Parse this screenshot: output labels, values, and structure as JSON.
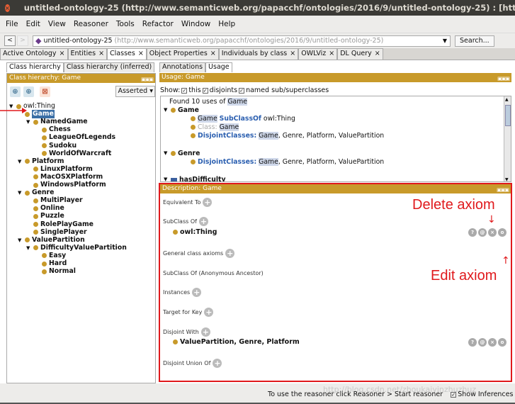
{
  "window": {
    "title": "untitled-ontology-25 (http://www.semanticweb.org/papacchf/ontologies/2016/9/untitled-ontology-25) : [http://www.semanticweb.o"
  },
  "menu": [
    "File",
    "Edit",
    "View",
    "Reasoner",
    "Tools",
    "Refactor",
    "Window",
    "Help"
  ],
  "address": {
    "back": "<",
    "forward": ">",
    "name": "untitled-ontology-25",
    "url": "(http://www.semanticweb.org/papacchf/ontologies/2016/9/untitled-ontology-25)",
    "search": "Search..."
  },
  "tabs": [
    {
      "label": "Active Ontology",
      "active": false
    },
    {
      "label": "Entities",
      "active": false
    },
    {
      "label": "Classes",
      "active": true
    },
    {
      "label": "Object Properties",
      "active": false
    },
    {
      "label": "Individuals by class",
      "active": false
    },
    {
      "label": "OWLViz",
      "active": false
    },
    {
      "label": "DL Query",
      "active": false
    }
  ],
  "left": {
    "subtabs": [
      "Class hierarchy",
      "Class hierarchy (inferred)"
    ],
    "header": "Class hierarchy: Game",
    "asserted": "Asserted ▾",
    "tree": [
      {
        "label": "owl:Thing",
        "bold": false,
        "toggle": "▼"
      },
      {
        "label": "Game",
        "bold": true,
        "toggle": "",
        "selected": true
      },
      {
        "label": "NamedGame",
        "bold": true,
        "toggle": "▼"
      },
      {
        "label": "Chess",
        "bold": true,
        "toggle": ""
      },
      {
        "label": "LeagueOfLegends",
        "bold": true,
        "toggle": ""
      },
      {
        "label": "Sudoku",
        "bold": true,
        "toggle": ""
      },
      {
        "label": "WorldOfWarcraft",
        "bold": true,
        "toggle": ""
      },
      {
        "label": "Platform",
        "bold": true,
        "toggle": "▼"
      },
      {
        "label": "LinuxPlatform",
        "bold": true,
        "toggle": ""
      },
      {
        "label": "MacOSXPlatform",
        "bold": true,
        "toggle": ""
      },
      {
        "label": "WindowsPlatform",
        "bold": true,
        "toggle": ""
      },
      {
        "label": "Genre",
        "bold": true,
        "toggle": "▼"
      },
      {
        "label": "MultiPlayer",
        "bold": true,
        "toggle": ""
      },
      {
        "label": "Online",
        "bold": true,
        "toggle": ""
      },
      {
        "label": "Puzzle",
        "bold": true,
        "toggle": ""
      },
      {
        "label": "RolePlayGame",
        "bold": true,
        "toggle": ""
      },
      {
        "label": "SinglePlayer",
        "bold": true,
        "toggle": ""
      },
      {
        "label": "ValuePartition",
        "bold": true,
        "toggle": "▼"
      },
      {
        "label": "DifficultyValuePartition",
        "bold": true,
        "toggle": "▼"
      },
      {
        "label": "Easy",
        "bold": true,
        "toggle": ""
      },
      {
        "label": "Hard",
        "bold": true,
        "toggle": ""
      },
      {
        "label": "Normal",
        "bold": true,
        "toggle": ""
      }
    ]
  },
  "right": {
    "subtabs": [
      "Annotations",
      "Usage"
    ],
    "usage_header": "Usage: Game",
    "show_label": "Show:",
    "show_this": "this",
    "show_disjoints": "disjoints",
    "show_named": "named sub/superclasses",
    "found": "Found 10 uses of",
    "found_entity": "Game",
    "usage": {
      "g1_head": "Game",
      "g1_l1_a": "Game",
      "g1_l1_kw": "SubClassOf",
      "g1_l1_b": "owl:Thing",
      "g1_l2_kw": "Class:",
      "g1_l2_b": "Game",
      "g1_l3_kw": "DisjointClasses:",
      "g1_l3_hl": "Game",
      "g1_l3_rest": ", Genre, Platform, ValuePartition",
      "g2_head": "Genre",
      "g2_l1_kw": "DisjointClasses:",
      "g2_l1_hl": "Game",
      "g2_l1_rest": ", Genre, Platform, ValuePartition",
      "g3_head": "hasDifficulty"
    },
    "desc_header": "Description: Game",
    "sections": {
      "equiv": "Equivalent To",
      "subclass": "SubClass Of",
      "subclass_axiom": "owl:Thing",
      "general": "General class axioms",
      "anon": "SubClass Of (Anonymous Ancestor)",
      "instances": "Instances",
      "target": "Target for Key",
      "disjoint": "Disjoint With",
      "disjoint_axiom": "ValuePartition, Genre, Platform",
      "disjoint_union": "Disjoint Union Of"
    },
    "annotations": {
      "delete": "Delete axiom",
      "edit": "Edit axiom"
    }
  },
  "status": {
    "text": "To use the reasoner click Reasoner > Start reasoner",
    "show_inferences": "Show Inferences",
    "watermark": "http://blog.csdn.net/zhoukaiyinzhuzhuz"
  },
  "colors": {
    "accent_panel": "#c89a2a",
    "annotation_red": "#e0191c",
    "selection_blue": "#3a6ea5",
    "keyword_blue": "#2b5fb0"
  }
}
